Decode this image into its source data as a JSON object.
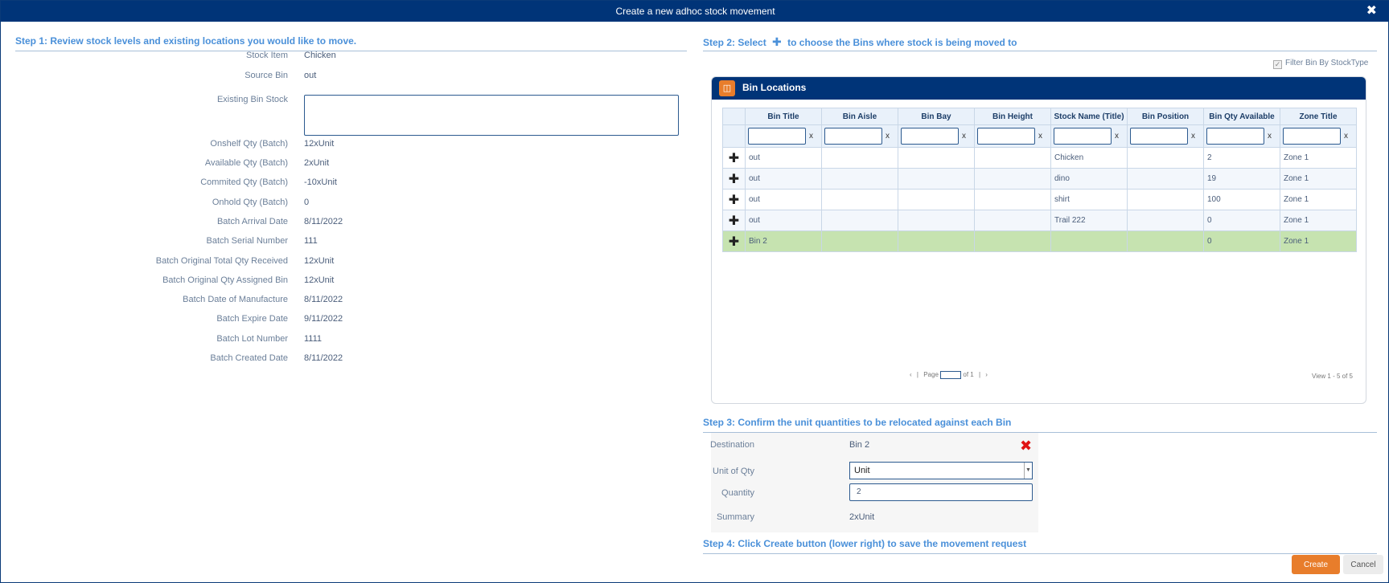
{
  "dialog": {
    "title": "Create a new adhoc stock movement",
    "close_icon": "close-icon"
  },
  "step1": {
    "heading": "Step 1: Review stock levels and existing locations you would like to move.",
    "fields": [
      {
        "label": "Stock Item",
        "value": "Chicken"
      },
      {
        "label": "Source Bin",
        "value": "out"
      },
      {
        "label": "Existing Bin Stock",
        "value": ""
      },
      {
        "label": "Onshelf Qty (Batch)",
        "value": "12xUnit"
      },
      {
        "label": "Available Qty (Batch)",
        "value": "2xUnit"
      },
      {
        "label": "Commited Qty (Batch)",
        "value": "-10xUnit"
      },
      {
        "label": "Onhold Qty (Batch)",
        "value": "0"
      },
      {
        "label": "Batch Arrival Date",
        "value": "8/11/2022"
      },
      {
        "label": "Batch Serial Number",
        "value": "111"
      },
      {
        "label": "Batch Original Total Qty Received",
        "value": "12xUnit"
      },
      {
        "label": "Batch Original Qty Assigned Bin",
        "value": "12xUnit"
      },
      {
        "label": "Batch Date of Manufacture",
        "value": "8/11/2022"
      },
      {
        "label": "Batch Expire Date",
        "value": "9/11/2022"
      },
      {
        "label": "Batch Lot Number",
        "value": "1111"
      },
      {
        "label": "Batch Created Date",
        "value": "8/11/2022"
      }
    ]
  },
  "step2": {
    "heading_pre": "Step 2: Select",
    "heading_post": "to choose the Bins where stock is being moved to",
    "filter_label": "Filter Bin By StockType",
    "panel_title": "Bin Locations",
    "columns": [
      "Bin Title",
      "Bin Aisle",
      "Bin Bay",
      "Bin Height",
      "Stock Name (Title)",
      "Bin Position",
      "Bin Qty Available",
      "Zone Title"
    ],
    "clear_label": "x",
    "rows": [
      [
        "out",
        "",
        "",
        "",
        "Chicken",
        "",
        "2",
        "Zone 1"
      ],
      [
        "out",
        "",
        "",
        "",
        "dino",
        "",
        "19",
        "Zone 1"
      ],
      [
        "out",
        "",
        "",
        "",
        "shirt",
        "",
        "100",
        "Zone 1"
      ],
      [
        "out",
        "",
        "",
        "",
        "Trail 222",
        "",
        "0",
        "Zone 1"
      ],
      [
        "Bin 2",
        "",
        "",
        "",
        "",
        "",
        "0",
        "Zone 1"
      ]
    ],
    "selected_row": 4,
    "pager": {
      "page_label": "Page",
      "page_value": "1",
      "of_label": "of 1"
    },
    "view_info": "View 1 - 5 of 5"
  },
  "step3": {
    "heading": "Step 3: Confirm the unit quantities to be relocated against each Bin",
    "destination_label": "Destination",
    "destination_value": "Bin 2",
    "unit_label": "Unit of Qty",
    "unit_value": "Unit",
    "quantity_label": "Quantity",
    "quantity_value": "2",
    "summary_label": "Summary",
    "summary_value": "2xUnit"
  },
  "step4": {
    "heading": "Step 4: Click Create button (lower right) to save the movement request"
  },
  "footer": {
    "create_label": "Create",
    "cancel_label": "Cancel"
  },
  "colors": {
    "header": "#003478",
    "accent": "#e87d2b",
    "step_heading": "#4a90d9",
    "selected_row": "#c6e3b0"
  }
}
